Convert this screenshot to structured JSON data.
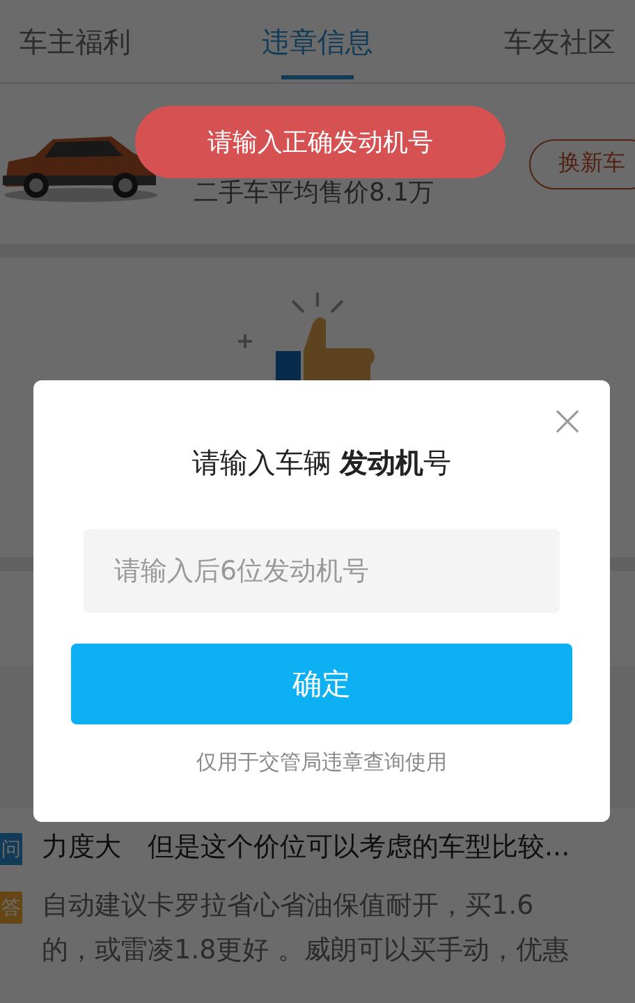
{
  "tabs": [
    {
      "label": "车主福利",
      "selected": false
    },
    {
      "label": "违章信息",
      "selected": true
    },
    {
      "label": "车友社区",
      "selected": false
    }
  ],
  "car_card": {
    "kind": "picture",
    "price": "二手车平均售价8.1万",
    "button": "换新车"
  },
  "toast": "请输入正确发动机号",
  "dialog": {
    "title": "请输入车辆 **发动机**号",
    "placeholder": "请输入后6位发动机号",
    "confirm": "确定",
    "note": "仅用于交管局违章查询使用"
  },
  "qa": [
    {
      "kind": "question",
      "badge": "问",
      "lines": [
        "力度大　但是这个价位可以考虑的车型比较..."
      ]
    },
    {
      "kind": "answer",
      "badge": "答",
      "lines": [
        "自动建议卡罗拉省心省油保值耐开，买1.6",
        "的，或雷凌1.8更好 。威朗可以买手动，优惠"
      ]
    }
  ]
}
